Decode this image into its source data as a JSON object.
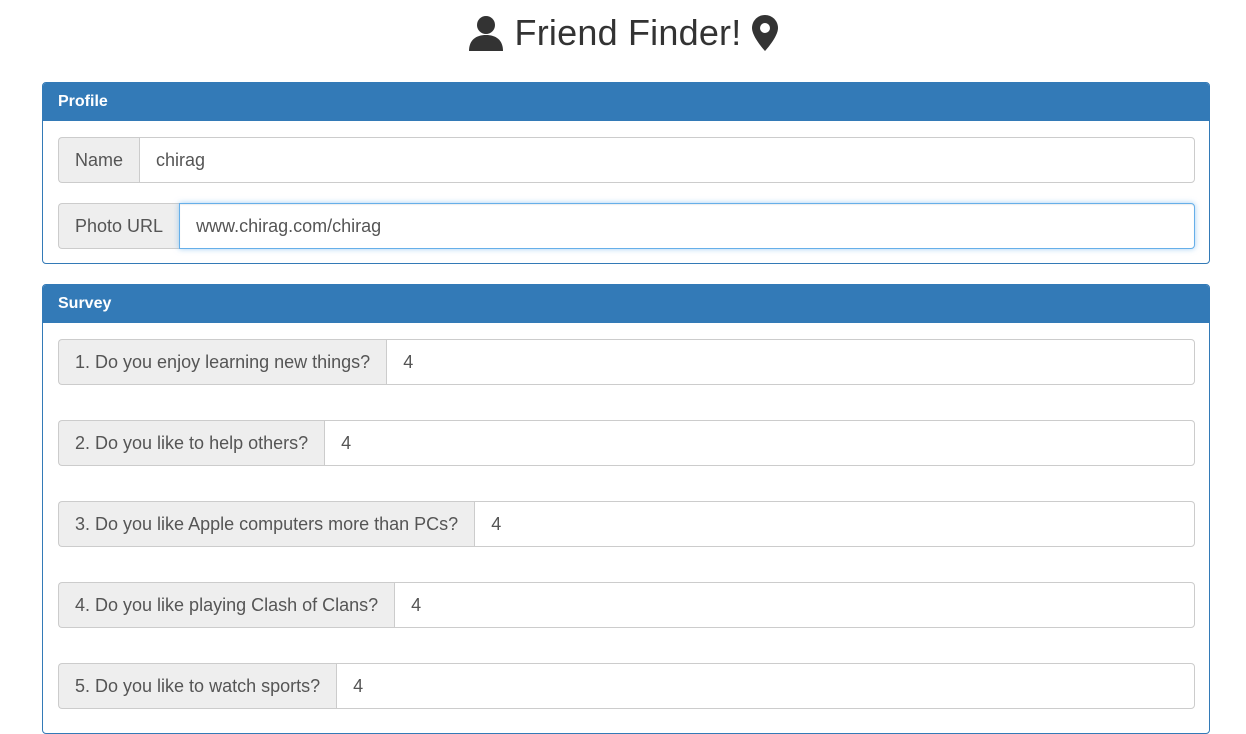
{
  "header": {
    "title": "Friend Finder!",
    "left_icon": "user-icon",
    "right_icon": "map-marker-icon"
  },
  "profile": {
    "heading": "Profile",
    "name_label": "Name",
    "name_value": "chirag",
    "photo_label": "Photo URL",
    "photo_value": "www.chirag.com/chirag"
  },
  "survey": {
    "heading": "Survey",
    "questions": [
      {
        "label": "1. Do you enjoy learning new things?",
        "value": "4"
      },
      {
        "label": "2. Do you like to help others?",
        "value": "4"
      },
      {
        "label": "3. Do you like Apple computers more than PCs?",
        "value": "4"
      },
      {
        "label": "4. Do you like playing Clash of Clans?",
        "value": "4"
      },
      {
        "label": "5. Do you like to watch sports?",
        "value": "4"
      }
    ]
  },
  "colors": {
    "panel_primary": "#337ab7",
    "addon_bg": "#eeeeee",
    "focus_border": "#66afe9"
  }
}
